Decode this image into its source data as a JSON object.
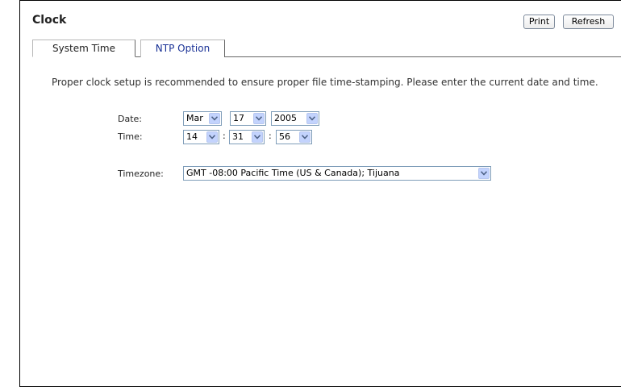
{
  "header": {
    "title": "Clock",
    "print_label": "Print",
    "refresh_label": "Refresh"
  },
  "tabs": [
    {
      "label": "System Time",
      "active": true
    },
    {
      "label": "NTP Option",
      "active": false
    }
  ],
  "intro_text": "Proper clock setup is recommended to ensure proper file time-stamping. Please enter the current date and time.",
  "date": {
    "label": "Date:",
    "month": "Mar",
    "day": "17",
    "year": "2005"
  },
  "time": {
    "label": "Time:",
    "hour": "14",
    "minute": "31",
    "second": "56",
    "separator": ":"
  },
  "timezone": {
    "label": "Timezone:",
    "value": "GMT -08:00 Pacific Time (US & Canada); Tijuana"
  },
  "colors": {
    "tab_link": "#1a3296",
    "select_border": "#7f9db9",
    "select_arrow_bg": "#c3d3fd",
    "select_arrow_glyph": "#4d6185"
  },
  "icons": {
    "dropdown": "chevron-down-icon"
  }
}
